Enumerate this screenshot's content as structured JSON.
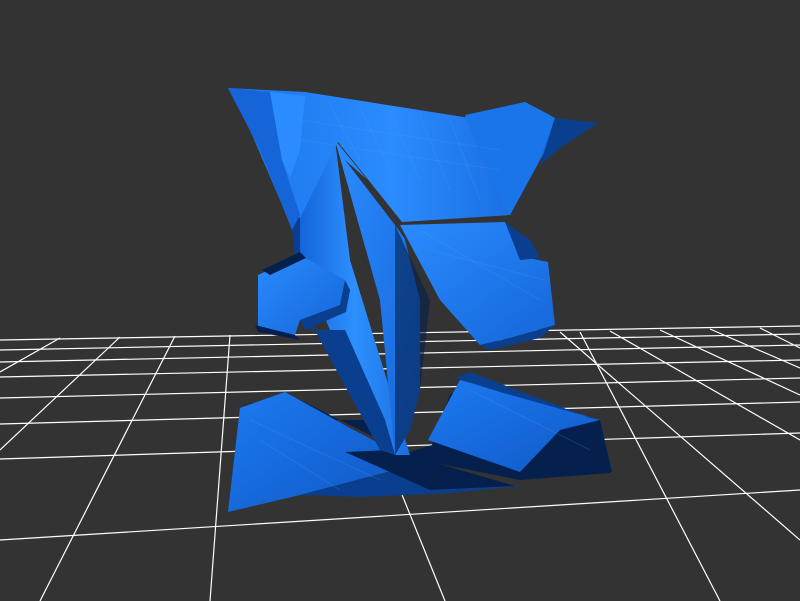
{
  "scene": {
    "background": "#333333",
    "grid_color": "#ffffff",
    "mesh_colors": {
      "light": "#1e88ff",
      "mid": "#1565d8",
      "dark": "#0a3f8f",
      "shadow": "#05204d"
    }
  }
}
